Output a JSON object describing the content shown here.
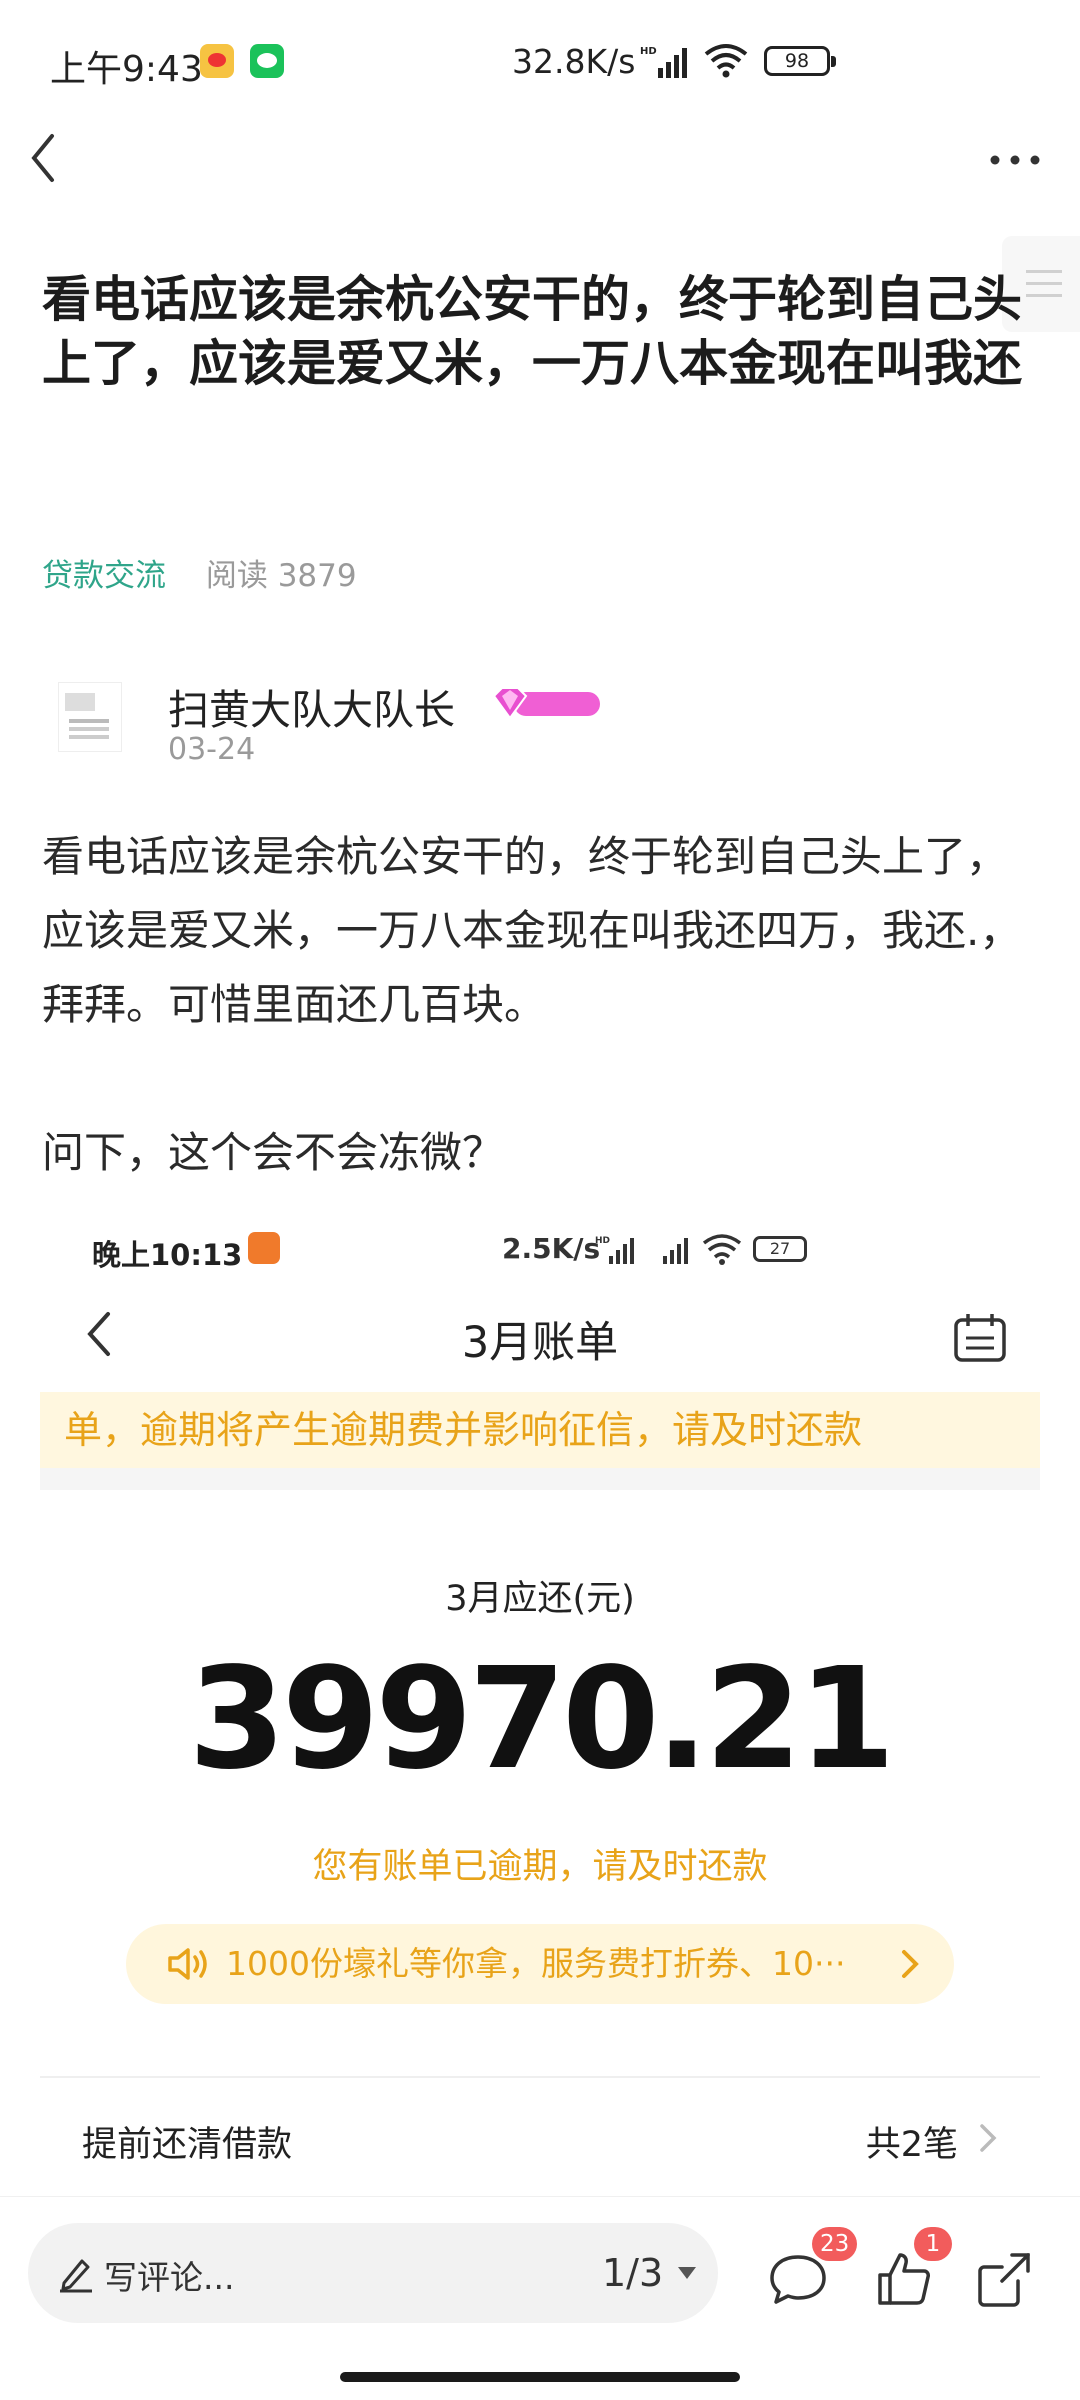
{
  "status_bar": {
    "time": "上午9:43",
    "speed": "32.8K/s",
    "battery": "98",
    "icons": [
      "weibo-icon",
      "wechat-icon",
      "signal-icon",
      "wifi-icon",
      "battery-icon"
    ]
  },
  "nav": {
    "back_icon": "chevron-left-icon",
    "more_icon": "more-icon"
  },
  "post": {
    "title": "看电话应该是余杭公安干的，终于轮到自己头上了，应该是爱又米，一万八本金现在叫我还",
    "tag": "贷款交流",
    "read_count": "阅读 3879",
    "author": "扫黄大队大队长",
    "date": "03-24",
    "body_p1": "看电话应该是余杭公安干的，终于轮到自己头上了，应该是爱又米，一万八本金现在叫我还四万，我还.，拜拜。可惜里面还几百块。",
    "body_p2": "问下，这个会不会冻微？"
  },
  "screenshot": {
    "time": "晚上10:13",
    "speed": "2.5K/s",
    "battery": "27",
    "title": "3月账单",
    "notice": "单，逾期将产生逾期费并影响征信，请及时还款",
    "due_label": "3月应还(元)",
    "amount": "39970.21",
    "overdue_msg": "您有账单已逾期，请及时还款",
    "promo": "1000份壕礼等你拿，服务费打折券、10···",
    "prepay_label": "提前还清借款",
    "prepay_count": "共2笔",
    "colors": {
      "accent": "#e8a319",
      "notice_bg": "#fff7df"
    }
  },
  "bottom": {
    "comment_placeholder": "写评论...",
    "page": "1/3",
    "comment_count": "23",
    "like_count": "1"
  },
  "colors": {
    "tag": "#2fa58a",
    "badge": "#f25c5c"
  }
}
